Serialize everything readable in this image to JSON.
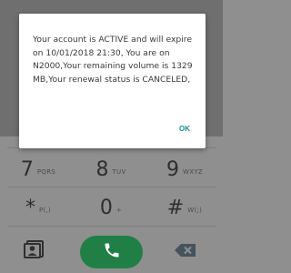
{
  "dialog": {
    "message": "Your account is ACTIVE and will expire on 10/01/2018 21:30, You are on N2000,Your remaining volume is 1329 MB,Your renewal status is CANCELED,",
    "ok_label": "OK"
  },
  "keypad": {
    "keys": [
      {
        "digit": "7",
        "letters": "PQRS"
      },
      {
        "digit": "8",
        "letters": "TUV"
      },
      {
        "digit": "9",
        "letters": "WXYZ"
      },
      {
        "digit": "*",
        "letters": "P(,)"
      },
      {
        "digit": "0",
        "letters": "+"
      },
      {
        "digit": "#",
        "letters": "W(;)"
      }
    ]
  },
  "colors": {
    "call_button": "#1f7f45",
    "ok_text": "#1a8f8a"
  },
  "icons": {
    "contacts": "contacts-icon",
    "call": "phone-icon",
    "backspace": "backspace-icon"
  }
}
